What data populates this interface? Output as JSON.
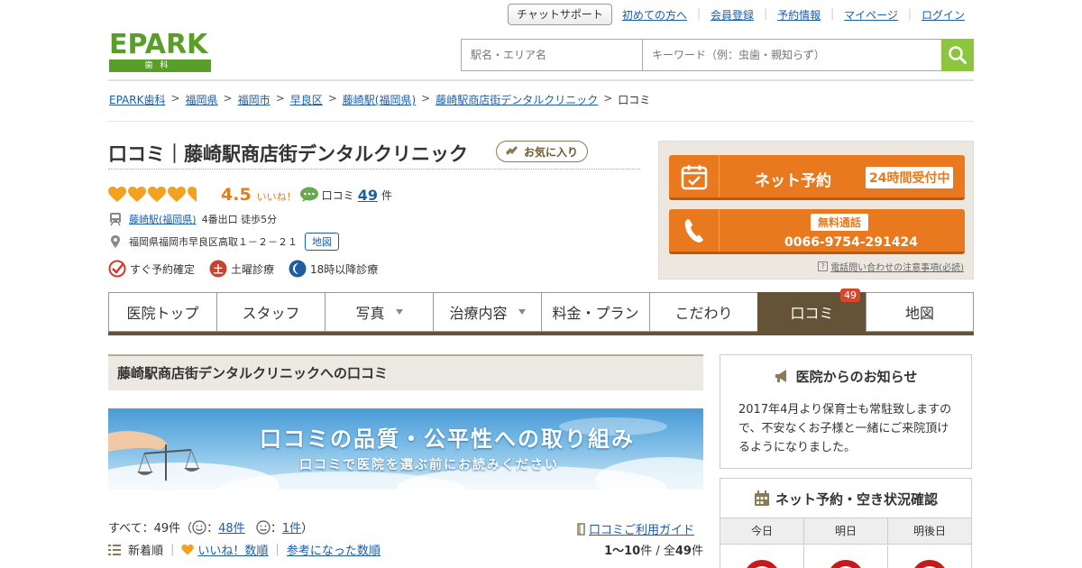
{
  "header": {
    "chat_support": "チャットサポート",
    "links": [
      "初めての方へ",
      "会員登録",
      "予約情報",
      "マイページ",
      "ログイン"
    ],
    "logo_text": "EPARK",
    "logo_sub": "歯科",
    "search": {
      "station_placeholder": "駅名・エリア名",
      "keyword_placeholder": "キーワード（例：虫歯・親知らず）"
    }
  },
  "breadcrumb": {
    "items": [
      "EPARK歯科",
      "福岡県",
      "福岡市",
      "早良区",
      "藤崎駅(福岡県)",
      "藤崎駅商店街デンタルクリニック"
    ],
    "current": "口コミ"
  },
  "clinic": {
    "title": "口コミ｜藤崎駅商店街デンタルクリニック",
    "favorite": "お気に入り",
    "rating": "4.5",
    "rating_value": 4.5,
    "iine": "いいね！",
    "review_label": "口コミ",
    "review_count": "49",
    "review_unit": "件",
    "station": "藤崎駅(福岡県)",
    "access": "4番出口 徒歩5分",
    "address": "福岡県福岡市早良区高取１－２－２１",
    "map": "地図",
    "features": [
      "すぐ予約確定",
      "土曜診療",
      "18時以降診療"
    ]
  },
  "booking": {
    "net_label": "ネット予約",
    "net_badge": "24時間受付中",
    "free_badge": "無料通話",
    "tel": "0066-9754-291424",
    "tel_note": "電話問い合わせの注意事項(必読)"
  },
  "tabs": {
    "items": [
      "医院トップ",
      "スタッフ",
      "写真",
      "治療内容",
      "料金・プラン",
      "こだわり",
      "口コミ",
      "地図"
    ],
    "review_badge": "49"
  },
  "main": {
    "section_title": "藤崎駅商店街デンタルクリニックへの口コミ",
    "banner_title": "口コミの品質・公平性への取り組み",
    "banner_sub": "口コミで医院を選ぶ前にお読みください",
    "filter_all": "すべて：49件（",
    "filter_good_count": "48件",
    "filter_neutral_count": "1件",
    "filter_close": "）",
    "guide": "口コミご利用ガイド",
    "sort_new": "新着順",
    "sort_iine": "いいね！数順",
    "sort_helpful": "参考になった数順",
    "paging_range": "1～10",
    "paging_unit": "件 /  全",
    "paging_total": "49",
    "paging_end": "件"
  },
  "sidebar": {
    "notice_title": "医院からのお知らせ",
    "notice_text": "2017年4月より保育士も常駐致しますので、不安なくお子様と一緒にご来院頂けるようになりました。",
    "avail_title": "ネット予約・空き状況確認",
    "days": [
      "今日",
      "明日",
      "明後日"
    ]
  },
  "colors": {
    "brand_green": "#5a9e2a",
    "accent_orange": "#e8791f",
    "tab_brown": "#655337",
    "link_blue": "#1a5ea8"
  }
}
